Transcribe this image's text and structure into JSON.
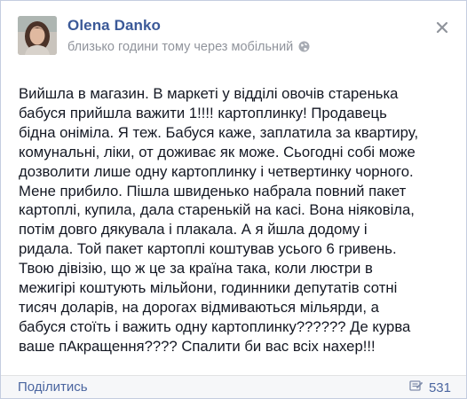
{
  "post": {
    "author": "Olena Danko",
    "meta": "близько години тому через мобільний",
    "text": "Вийшла в магазин. В маркеті у відділі овочів старенька\nбабуся прийшла важити 1!!!! картоплинку! Продавець\nбідна оніміла. Я теж. Бабуся каже, заплатила за квартиру,\nкомунальні, ліки, от доживає як може. Сьогодні собі може\nдозволити лише одну картоплинку і четвертинку чорного.\nМене прибило. Пішла швиденько набрала повний пакет\nкартоплі, купила, дала старенькій на касі. Вона ніяковіла,\nпотім довго дякувала і плакала. А я йшла додому і\nридала. Той пакет картоплі коштував усього 6 гривень.\nТвою дівізію, що ж це за країна така, коли люстри в\nмежигірі коштують мільйони, годинники депутатів сотні\nтисяч доларів, на дорогах відмиваються мільярди, а\nбабуся стоїть і важить одну картоплинку?????? Де курва\nваше пАкращення???? Спалити би вас всіх нахер!!!"
  },
  "footer": {
    "share_label": "Поділитись",
    "share_count": "531"
  },
  "icons": {
    "visibility": "globe-icon",
    "close": "close-icon",
    "shares": "shares-icon"
  },
  "colors": {
    "link": "#3b5998",
    "meta": "#90949c",
    "text": "#141823",
    "footer_bg": "#f6f7f9"
  }
}
